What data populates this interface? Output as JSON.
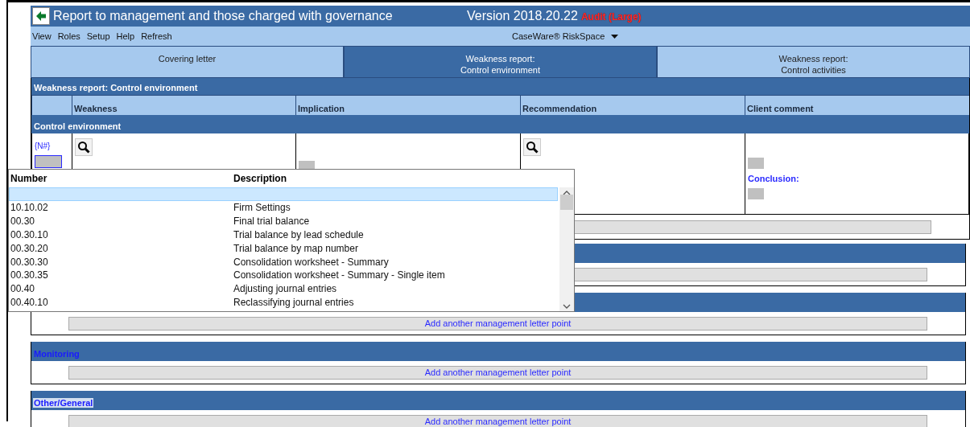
{
  "window": {
    "title": "Report to management and those charged with governance",
    "version": "Version 2018.20.22",
    "edition": "Audit (Large)"
  },
  "menu": [
    "View",
    "Roles",
    "Setup",
    "Help",
    "Refresh"
  ],
  "product_menu": {
    "label": "CaseWare® RiskSpace"
  },
  "tabs": [
    {
      "lines": [
        "Covering letter"
      ],
      "selected": false
    },
    {
      "lines": [
        "Weakness report:",
        "Control environment"
      ],
      "selected": true
    },
    {
      "lines": [
        "Weakness report:",
        "Control activities"
      ],
      "selected": false
    }
  ],
  "report": {
    "title": "Weakness report: Control environment",
    "columns": [
      "Weakness",
      "Implication",
      "Recommendation",
      "Client comment"
    ],
    "section": "Control environment",
    "number_code": "{N#}",
    "conclusion_label": "Conclusion:"
  },
  "sections": [
    {
      "add_button": true
    },
    {
      "add_button": true,
      "add_label": "Add another management letter point"
    },
    {
      "label": "Monitoring",
      "highlighted": false,
      "add_button": true,
      "add_label": "Add another management letter point"
    },
    {
      "label": "Other/General",
      "highlighted": true,
      "add_button": true,
      "add_label": "Add another management letter point"
    }
  ],
  "dropdown": {
    "columns": [
      "Number",
      "Description"
    ],
    "rows": [
      {
        "selected": true
      },
      {
        "number": "10.10.02",
        "description": "Firm Settings",
        "selected": false
      },
      {
        "number": "00.30",
        "description": "Final trial balance",
        "selected": false
      },
      {
        "number": "00.30.10",
        "description": "Trial balance by lead schedule",
        "selected": false
      },
      {
        "number": "00.30.20",
        "description": "Trial balance by map number",
        "selected": false
      },
      {
        "number": "00.30.30",
        "description": "Consolidation worksheet - Summary",
        "selected": false
      },
      {
        "number": "00.30.35",
        "description": "Consolidation worksheet - Summary - Single item",
        "selected": false
      },
      {
        "number": "00.40",
        "description": "Adjusting journal entries",
        "selected": false
      },
      {
        "number": "00.40.10",
        "description": "Reclassifying journal entries",
        "selected": false
      }
    ]
  }
}
